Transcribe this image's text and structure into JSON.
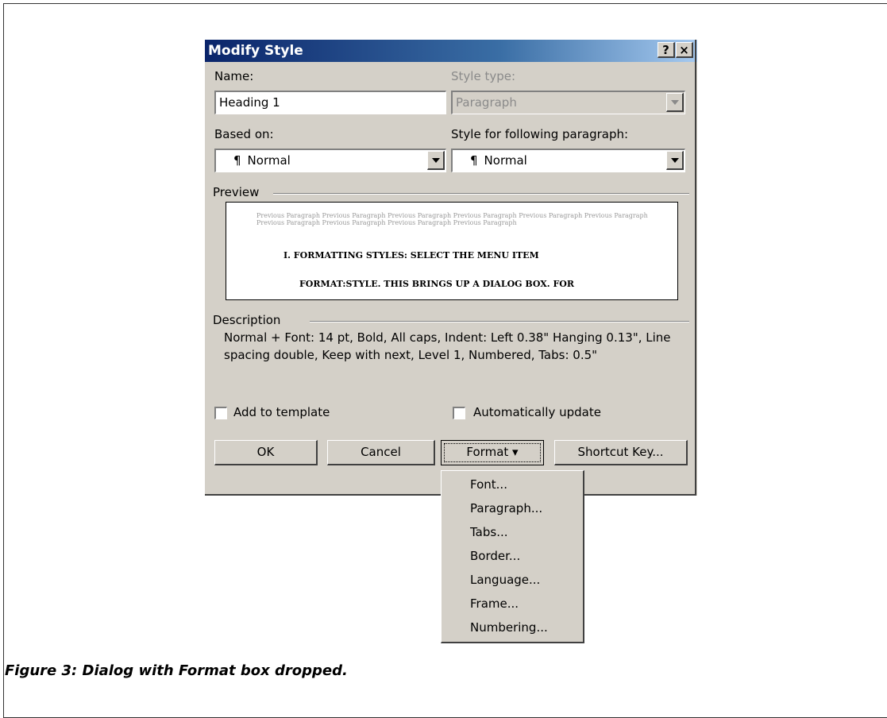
{
  "dialog": {
    "title": "Modify Style",
    "help_label": "?",
    "close_label": "×",
    "name_label": "Name:",
    "name_value": "Heading 1",
    "style_type_label": "Style type:",
    "style_type_value": "Paragraph",
    "based_on_label": "Based on:",
    "based_on_value": "Normal",
    "following_label": "Style for following paragraph:",
    "following_value": "Normal",
    "pilcrow": "¶",
    "preview_label": "Preview",
    "preview_previous": "Previous Paragraph Previous Paragraph Previous Paragraph Previous Paragraph Previous Paragraph Previous Paragraph Previous Paragraph Previous Paragraph Previous Paragraph Previous Paragraph",
    "preview_line1": "I.  FORMATTING STYLES: SELECT THE MENU ITEM",
    "preview_line2": "FORMAT:STYLE. THIS BRINGS UP A DIALOG BOX. FOR",
    "description_label": "Description",
    "description_text": "Normal + Font: 14 pt, Bold, All caps, Indent:  Left  0.38\" Hanging  0.13\", Line spacing double, Keep with next, Level 1, Numbered, Tabs: 0.5\"",
    "add_to_template": "Add to template",
    "auto_update": "Automatically update",
    "ok": "OK",
    "cancel": "Cancel",
    "format": "Format",
    "format_arrow": "▾",
    "shortcut": "Shortcut Key..."
  },
  "format_menu": {
    "items": [
      "Font...",
      "Paragraph...",
      "Tabs...",
      "Border...",
      "Language...",
      "Frame...",
      "Numbering..."
    ]
  },
  "caption": "Figure 3: Dialog with Format box dropped."
}
